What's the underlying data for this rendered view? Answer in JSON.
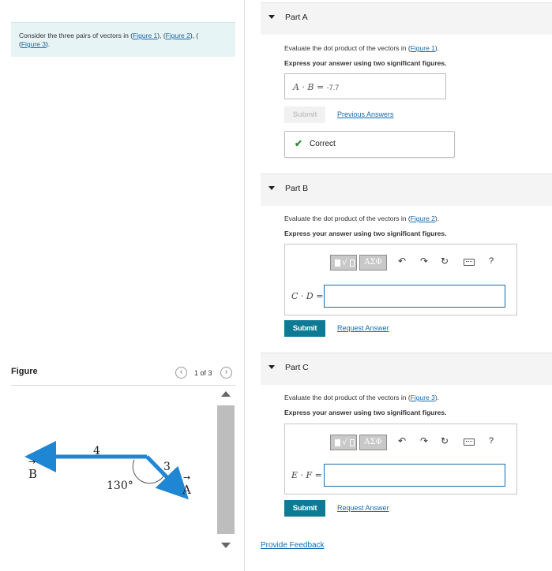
{
  "intro": {
    "text_before": "Consider the three pairs of vectors in (",
    "link1": "Figure 1",
    "sep1": "), (",
    "link2": "Figure 2",
    "sep2": "), (",
    "link3": "Figure 3",
    "text_after": ")."
  },
  "figure_panel": {
    "title": "Figure",
    "pager": "1 of 3",
    "prev_icon": "chevron-left-icon",
    "next_icon": "chevron-right-icon",
    "diagram": {
      "label_B": "B",
      "label_A": "A",
      "length_B": "4",
      "length_A": "3",
      "angle": "130°",
      "arrow_color": "#1f86d3"
    }
  },
  "partA": {
    "title": "Part A",
    "q_before": "Evaluate the dot product of the vectors in (",
    "q_link": "Figure 1",
    "q_after": ").",
    "instruction": "Express your answer using two significant figures.",
    "expr": "A · B =",
    "answer": "-7.7",
    "submit": "Submit",
    "prev_answers": "Previous Answers",
    "result": "Correct",
    "result_color": "#2f8a2f"
  },
  "partB": {
    "title": "Part B",
    "q_before": "Evaluate the dot product of the vectors in (",
    "q_link": "Figure 2",
    "q_after": ").",
    "instruction": "Express your answer using two significant figures.",
    "expr": "C · D =",
    "input_value": "",
    "submit": "Submit",
    "request": "Request Answer"
  },
  "partC": {
    "title": "Part C",
    "q_before": "Evaluate the dot product of the vectors in (",
    "q_link": "Figure 3",
    "q_after": ").",
    "instruction": "Express your answer using two significant figures.",
    "expr": "E · F =",
    "input_value": "",
    "submit": "Submit",
    "request": "Request Answer"
  },
  "toolbar": {
    "greek_label": "ΑΣΦ",
    "help": "?"
  },
  "feedback": "Provide Feedback",
  "colors": {
    "submit_bg": "#0f7a93",
    "link": "#1a6aa8",
    "intro_bg": "#e6f4f6"
  }
}
